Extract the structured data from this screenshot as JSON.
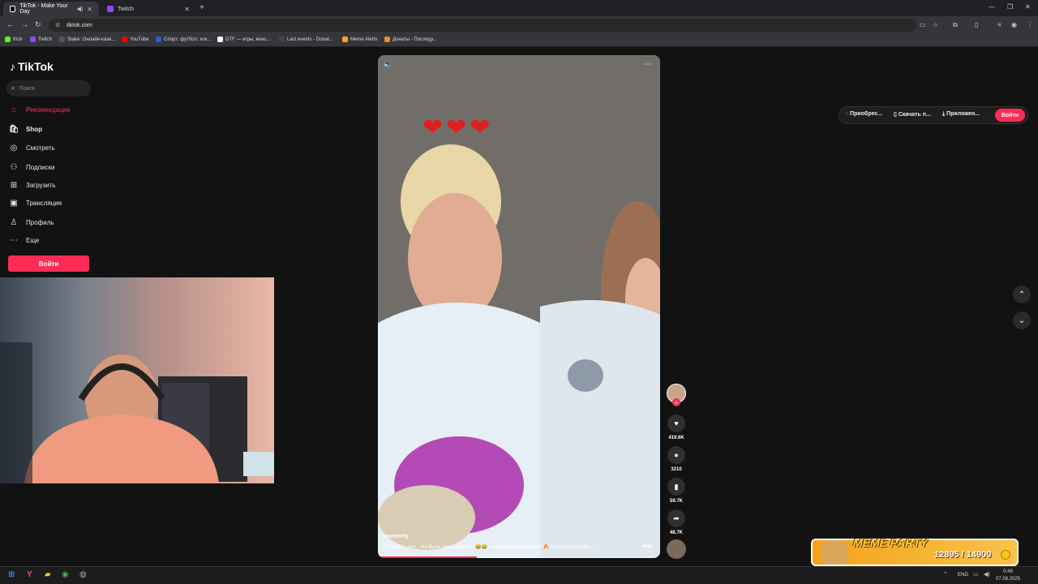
{
  "browser": {
    "tabs": [
      {
        "title": "TikTok - Make Your Day",
        "active": true
      },
      {
        "title": "Twitch",
        "active": false
      }
    ],
    "url": "tiktok.com",
    "bookmarks": [
      "Kick",
      "Twitch",
      "Stake: Онлайн-кази...",
      "YouTube",
      "Спорт: футбол, хок...",
      "DTF — игры, кино,...",
      "Last events - Donat...",
      "Meme Alerts",
      "Донаты - Последу..."
    ]
  },
  "tiktok": {
    "logo": "TikTok",
    "search_placeholder": "Поиск",
    "nav": [
      {
        "label": "Рекомендации",
        "icon": "home-icon"
      },
      {
        "label": "Shop",
        "icon": "shop-icon"
      },
      {
        "label": "Смотреть",
        "icon": "explore-icon"
      },
      {
        "label": "Подписки",
        "icon": "following-icon"
      },
      {
        "label": "Загрузить",
        "icon": "upload-icon"
      },
      {
        "label": "Трансляция",
        "icon": "live-icon"
      },
      {
        "label": "Профиль",
        "icon": "profile-icon"
      },
      {
        "label": "Еще",
        "icon": "more-icon"
      }
    ],
    "login_label": "Войти",
    "topbar": {
      "get_coins": "Приобрес...",
      "download": "Скачать п...",
      "app": "Приложен...",
      "login": "Войти"
    },
    "video": {
      "author": "nasmorty",
      "description": "@Zhanna_sam_ это было очень смешно 😂😂 твой смех великолепен 🔥 #снимаюсмамой ...",
      "more": "еще",
      "progress": 0.35
    },
    "actions": {
      "likes": "419.6K",
      "comments": "3210",
      "saves": "59.7K",
      "shares": "48.7K"
    }
  },
  "overlay": {
    "meme_title": "MEME PARTY",
    "meme_count": "12895 / 14900"
  },
  "taskbar": {
    "lang": "ENG",
    "time": "0:49",
    "date": "07.08.2025"
  }
}
